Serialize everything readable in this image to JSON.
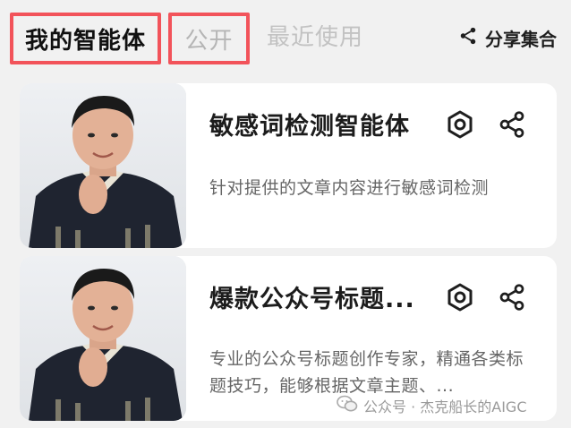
{
  "tabs": {
    "mine": "我的智能体",
    "public": "公开",
    "recent": "最近使用"
  },
  "header": {
    "share_collection_label": "分享集合",
    "share_icon": "share-icon"
  },
  "cards": [
    {
      "title": "敏感词检测智能体",
      "description": "针对提供的文章内容进行敏感词检测",
      "settings_icon": "settings-hexagon-icon",
      "share_icon": "share-icon"
    },
    {
      "title": "爆款公众号标题...",
      "description": "专业的公众号标题创作专家，精通各类标题技巧，能够根据文章主题、...",
      "settings_icon": "settings-hexagon-icon",
      "share_icon": "share-icon"
    }
  ],
  "watermark": {
    "text": "公众号 · 杰克船长的AIGC",
    "icon": "wechat-icon"
  },
  "colors": {
    "highlight_border": "#f2535a",
    "active_tab": "#111111",
    "inactive_tab": "#b5b5b5",
    "card_bg": "#ffffff",
    "page_bg": "#f1f1f1"
  }
}
